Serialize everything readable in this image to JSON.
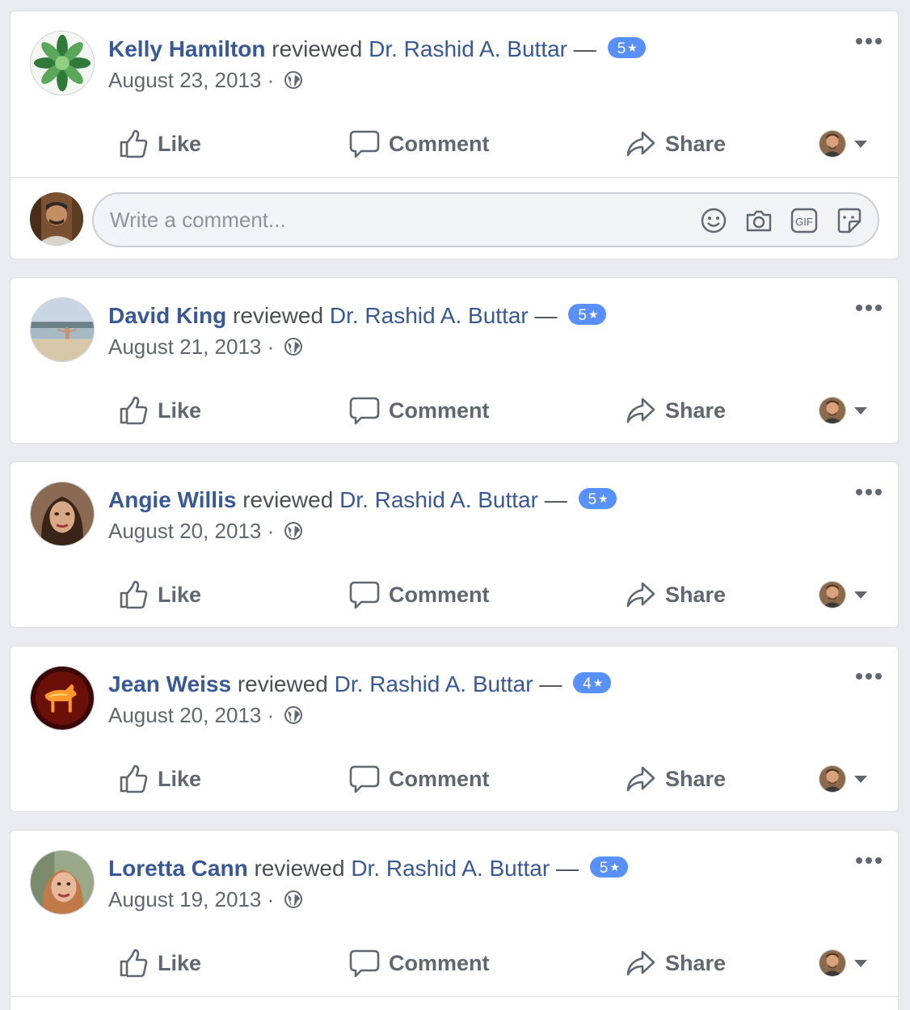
{
  "reviews": [
    {
      "author": "Kelly Hamilton",
      "verb": "reviewed",
      "page": "Dr. Rashid A. Buttar",
      "dash": "—",
      "rating": "5",
      "date": "August 23, 2013 ·",
      "avatar_icon": "green-flower-avatar"
    },
    {
      "author": "David King",
      "verb": "reviewed",
      "page": "Dr. Rashid A. Buttar",
      "dash": "—",
      "rating": "5",
      "date": "August 21, 2013 ·",
      "avatar_icon": "beach-avatar"
    },
    {
      "author": "Angie Willis",
      "verb": "reviewed",
      "page": "Dr. Rashid A. Buttar",
      "dash": "—",
      "rating": "5",
      "date": "August 20, 2013 ·",
      "avatar_icon": "woman-portrait-avatar"
    },
    {
      "author": "Jean Weiss",
      "verb": "reviewed",
      "page": "Dr. Rashid A. Buttar",
      "dash": "—",
      "rating": "4",
      "date": "August 20, 2013 ·",
      "avatar_icon": "glowing-horse-avatar"
    },
    {
      "author": "Loretta Cann",
      "verb": "reviewed",
      "page": "Dr. Rashid A. Buttar",
      "dash": "—",
      "rating": "5",
      "date": "August 19, 2013 ·",
      "avatar_icon": "woman-selfie-avatar"
    }
  ],
  "actions": {
    "like": "Like",
    "comment": "Comment",
    "share": "Share"
  },
  "comment_composer": {
    "placeholder": "Write a comment...",
    "icons": [
      "emoji-icon",
      "camera-icon",
      "gif-icon",
      "sticker-icon"
    ]
  },
  "colors": {
    "link": "#385898",
    "badge": "#5890ff",
    "muted": "#616770",
    "background": "#e9ebee"
  }
}
